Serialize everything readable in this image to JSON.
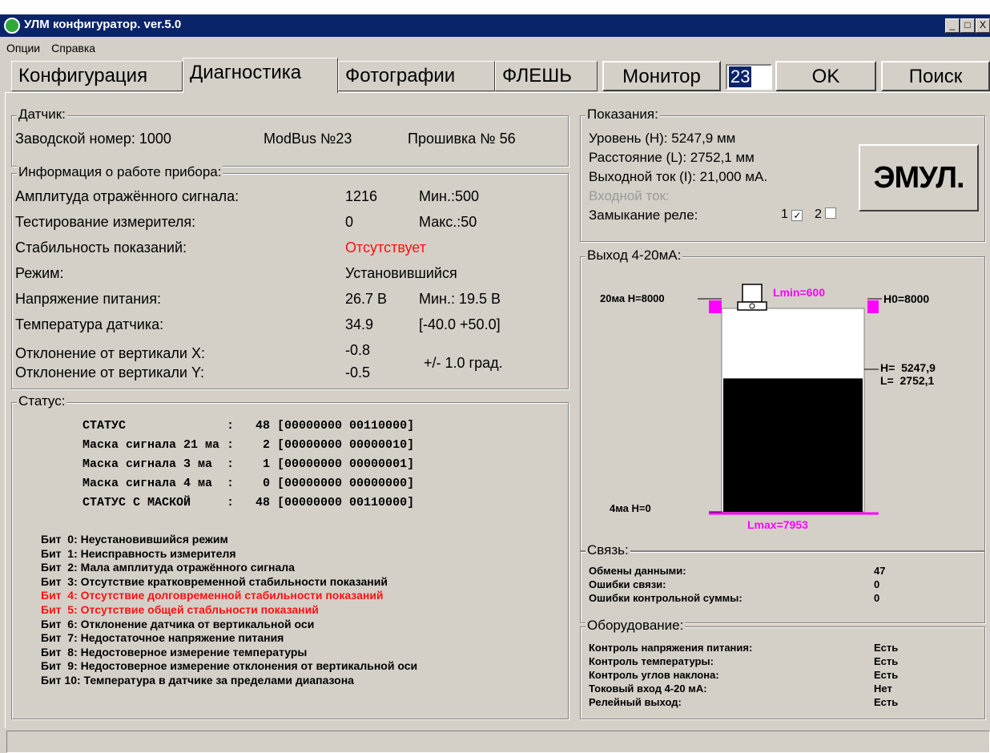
{
  "window": {
    "title": "УЛМ конфигуратор. ver.5.0",
    "controls": [
      "_",
      "□",
      "X"
    ]
  },
  "menu": [
    "Опции",
    "Справка"
  ],
  "tabs": [
    "Конфигурация",
    "Диагностика",
    "Фотографии",
    "ФЛЕШЬ"
  ],
  "active_tab": "Диагностика",
  "toolbar": {
    "monitor_label": "Монитор",
    "address_value": "23",
    "ok_label": "OK",
    "search_label": "Поиск"
  },
  "sensor": {
    "legend": "Датчик:",
    "serial": "Заводской номер: 1000",
    "modbus": "ModBus №23",
    "firmware": "Прошивка № 56"
  },
  "info": {
    "legend": "Информация о работе прибора:",
    "amp_label": "Амплитуда отражённого сигнала:",
    "amp_value": "1216",
    "amp_min": "Мин.:500",
    "test_label": "Тестирование измерителя:",
    "test_value": "0",
    "test_max": "Макс.:50",
    "stab_label": "Стабильность показаний:",
    "stab_value": "Отсутствует",
    "mode_label": "Режим:",
    "mode_value": "Установившийся",
    "volt_label": "Напряжение питания:",
    "volt_value": "26.7 В",
    "volt_min": "Мин.: 19.5 В",
    "temp_label": "Температура датчика:",
    "temp_value": "34.9",
    "temp_range": "[-40.0 +50.0]",
    "tiltx_label": "Отклонение от вертикали X:",
    "tiltx_value": "-0.8",
    "tilty_label": "Отклонение от вертикали Y:",
    "tilty_value": "-0.5",
    "tilt_range": "+/- 1.0 град."
  },
  "status": {
    "legend": "Статус:",
    "rows": [
      "СТАТУС              :   48 [00000000 00110000]",
      "Маска сигнала 21 ма :    2 [00000000 00000010]",
      "Маска сигнала 3 ма  :    1 [00000000 00000001]",
      "Маска сигнала 4 ма  :    0 [00000000 00000000]",
      "СТАТУС С МАСКОЙ     :   48 [00000000 00110000]"
    ],
    "bits": [
      "Бит  0: Неустановившийся режим",
      "Бит  1: Неисправность измерителя",
      "Бит  2: Мала амплитуда отражённого сигнала",
      "Бит  3: Отсутствие кратковременной стабильности показаний",
      "Бит  4: Отсутствие долговременной стабильности показаний",
      "Бит  5: Отсутствие общей стабльности показаний",
      "Бит  6: Отклонение датчика от вертикальной оси",
      "Бит  7: Недостаточное напряжение питания",
      "Бит  8: Недостоверное измерение температуры",
      "Бит  9: Недостоверное измерение отклонения от вертикальной оси",
      "Бит 10: Температура в датчике за пределами диапазона"
    ],
    "active_bits": [
      4,
      5
    ]
  },
  "readings": {
    "legend": "Показания:",
    "level": "Уровень       (H): 5247,9 мм",
    "distance": "Расстояние   (L): 2752,1 мм",
    "current_out": "Выходной ток (I): 21,000 мА.",
    "current_in": "Входной ток:",
    "relay_label": "Замыкание реле:",
    "relay1": "1",
    "relay1_checked": true,
    "relay2": "2",
    "relay2_checked": false,
    "emul_label": "ЭМУЛ."
  },
  "output": {
    "legend": "Выход 4-20мА:",
    "top_left": "20ма H=8000",
    "lmin": "Lmin=600",
    "h0": "H0=8000",
    "h_val": "H=  5247,9",
    "l_val": "L=  2752,1",
    "bottom_left": "4ма H=0",
    "lmax": "Lmax=7953",
    "fill_fraction": 0.656,
    "accent": "#ff00ff"
  },
  "link": {
    "legend": "Связь:",
    "rows": [
      [
        "Обмены данными:",
        "47"
      ],
      [
        "Ошибки связи:",
        "0"
      ],
      [
        "Ошибки контрольной суммы:",
        "0"
      ]
    ]
  },
  "hardware": {
    "legend": "Оборудование:",
    "rows": [
      [
        "Контроль напряжения питания:",
        "Есть"
      ],
      [
        "Контроль температуры:",
        "Есть"
      ],
      [
        "Контроль углов наклона:",
        "Есть"
      ],
      [
        "Токовый вход 4-20 мА:",
        "Нет"
      ],
      [
        "Релейный выход:",
        "Есть"
      ]
    ]
  }
}
